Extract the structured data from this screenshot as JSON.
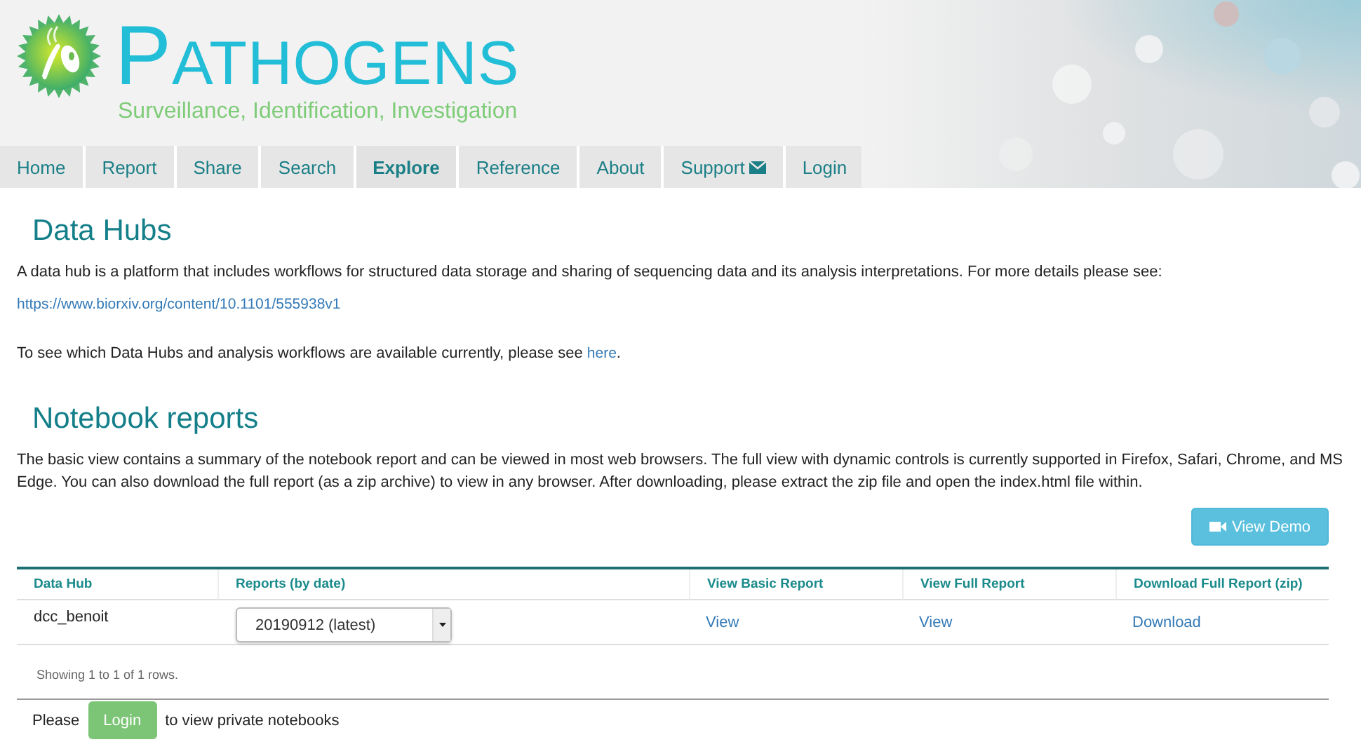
{
  "header": {
    "title": "PATHOGENS",
    "subtitle": "Surveillance, Identification, Investigation"
  },
  "nav": [
    {
      "label": "Home",
      "selected": false
    },
    {
      "label": "Report",
      "selected": false
    },
    {
      "label": "Share",
      "selected": false
    },
    {
      "label": "Search",
      "selected": false
    },
    {
      "label": "Explore",
      "selected": true
    },
    {
      "label": "Reference",
      "selected": false
    },
    {
      "label": "About",
      "selected": false
    },
    {
      "label": "Support",
      "selected": false,
      "kind": "contact"
    },
    {
      "label": "Login",
      "selected": false
    }
  ],
  "data_hubs": {
    "title": "Data Hubs",
    "intro": "A data hub is a platform that includes workflows for structured data storage and sharing of sequencing data and its analysis interpretations. For more details please see:",
    "link": "https://www.biorxiv.org/content/10.1101/555938v1",
    "availability_text": "To see which Data Hubs and analysis workflows are available currently, please see",
    "availability_link": "here",
    "availability_end": "."
  },
  "notebook_reports": {
    "title": "Notebook reports",
    "description": "The basic view contains a summary of the notebook report and can be viewed in most web browsers. The full view with dynamic controls is currently supported in Firefox, Safari, Chrome, and MS Edge. You can also download the full report (as a zip archive) to view in any browser. After downloading, please extract the zip file and open the index.html file within.",
    "demo_button": "View Demo"
  },
  "table": {
    "columns": [
      "Data Hub",
      "Reports (by date)",
      "View Basic Report",
      "View Full Report",
      "Download Full Report (zip)"
    ],
    "rows": [
      {
        "data_hub": "dcc_benoit",
        "report": "20190912 (latest)",
        "basic": "View",
        "full": "View",
        "download": "Download"
      }
    ],
    "footer": "Showing 1 to 1 of 1 rows."
  },
  "login_prompt": {
    "before": "Please",
    "button": "Login",
    "after": "to view private notebooks"
  }
}
